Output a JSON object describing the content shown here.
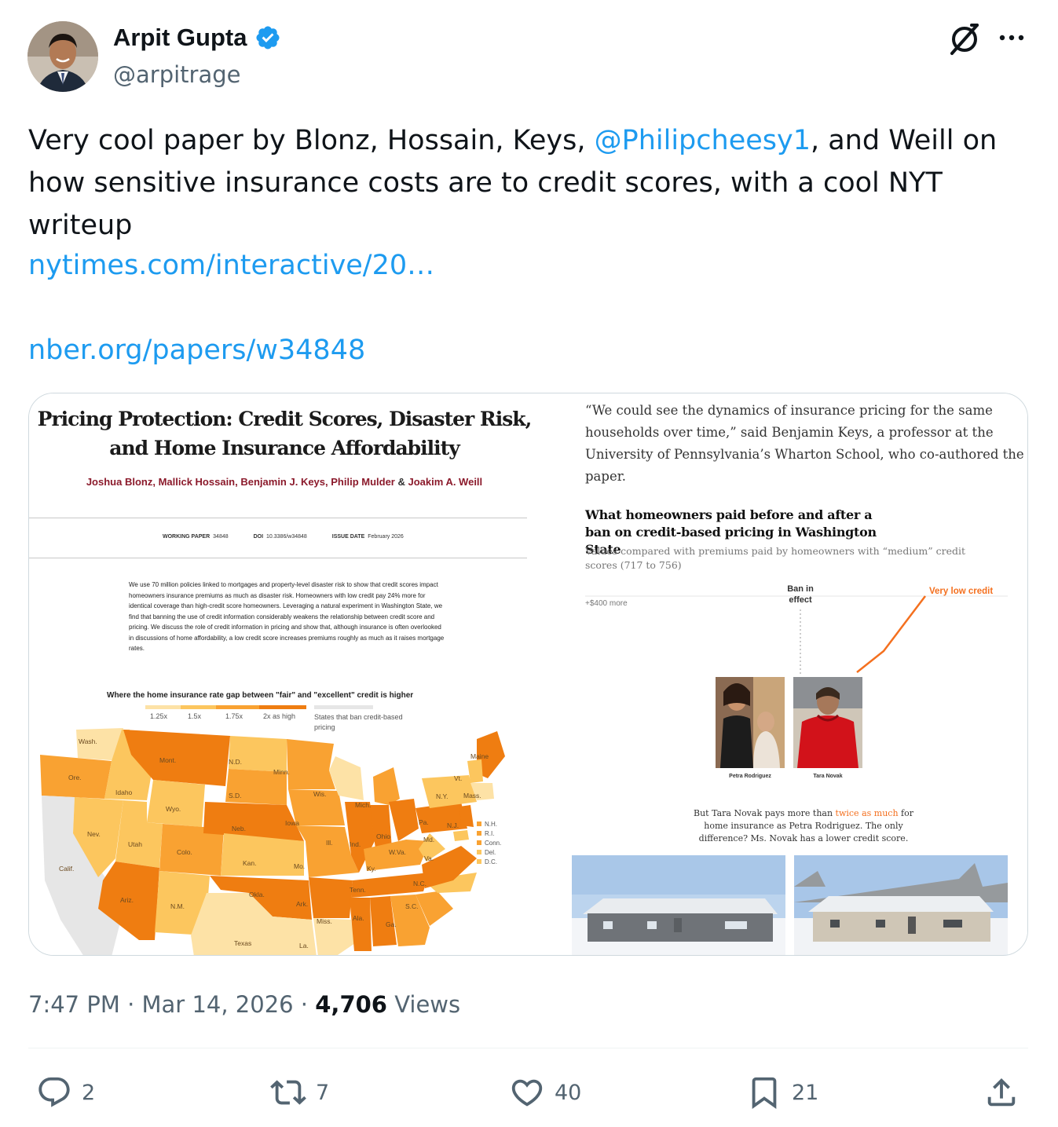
{
  "author": {
    "name": "Arpit Gupta",
    "handle": "@arpitrage"
  },
  "tweet": {
    "text_before": "Very cool paper by Blonz, Hossain, Keys, ",
    "mention": "@Philipcheesy1",
    "text_after": ", and Weill on how sensitive insurance costs are to credit scores, with a cool NYT writeup",
    "links": [
      "nytimes.com/interactive/20…",
      "nber.org/papers/w34848"
    ]
  },
  "paper": {
    "title": "Pricing Protection: Credit Scores, Disaster Risk, and Home Insurance Affordability",
    "authors": [
      "Joshua Blonz",
      "Mallick Hossain",
      "Benjamin J. Keys",
      "Philip Mulder",
      "Joakim A. Weill"
    ],
    "meta": {
      "wp_label": "WORKING PAPER",
      "wp_value": "34848",
      "doi_label": "DOI",
      "doi_value": "10.3386/w34848",
      "date_label": "ISSUE DATE",
      "date_value": "February 2026"
    },
    "abstract": "We use 70 million policies linked to mortgages and property-level disaster risk to show that credit scores impact homeowners insurance premiums as much as disaster risk. Homeowners with low credit pay 24% more for identical coverage than high-credit score homeowners. Leveraging a natural experiment in Washington State, we find that banning the use of credit information considerably weakens the relationship between credit score and pricing. We discuss the role of credit information in pricing and show that, although insurance is often overlooked in discussions of home affordability, a low credit score increases premiums roughly as much as it raises mortgage rates.",
    "map_title": "Where the home insurance rate gap between \"fair\" and \"excellent\" credit is higher",
    "legend": [
      "1.25x",
      "1.5x",
      "1.75x",
      "2x as high"
    ],
    "legend_ban": "States that ban credit-based pricing",
    "colors": {
      "c1": "#fde2a6",
      "c2": "#fcc65e",
      "c3": "#f9a232",
      "c4": "#ef7d11",
      "ban": "#e6e6e6"
    },
    "map_labels": [
      "Wash.",
      "Ore.",
      "Calif.",
      "Idaho",
      "Nev.",
      "Mont.",
      "Wyo.",
      "Utah",
      "Ariz.",
      "Colo.",
      "N.M.",
      "N.D.",
      "S.D.",
      "Neb.",
      "Kan.",
      "Okla.",
      "Texas",
      "Minn.",
      "Iowa",
      "Mo.",
      "Ark.",
      "La.",
      "Wis.",
      "Ill.",
      "Mich.",
      "Ind.",
      "Ohio",
      "Ky.",
      "Tenn.",
      "Miss.",
      "Ala.",
      "Ga.",
      "S.C.",
      "N.C.",
      "Va.",
      "W.Va.",
      "Md.",
      "Pa.",
      "N.J.",
      "N.Y.",
      "Vt.",
      "Mass.",
      "Maine"
    ],
    "ne_labels": [
      "N.H.",
      "R.I.",
      "Conn.",
      "Del.",
      "D.C."
    ]
  },
  "article": {
    "quote": "“We could see the dynamics of insurance pricing for the same households over time,” said Benjamin Keys, a professor at the University of Pennsylvania’s Wharton School, who co-authored the paper.",
    "chart_title": "What homeowners paid before and after a ban on credit-based pricing in Washington State",
    "chart_subtitle": "Values compared with premiums paid by homeowners with “medium” credit scores (717 to 756)",
    "y_label": "+$400 more",
    "ban_label": "Ban in effect",
    "line_label": "Very low credit",
    "line_color": "#f4701f",
    "photo1_name": "Petra Rodriguez",
    "photo2_name": "Tara Novak",
    "caption_before": "But Tara Novak pays more than ",
    "caption_highlight": "twice as much",
    "caption_after": " for home insurance as Petra Rodriguez. The only difference? Ms. Novak has a lower credit score."
  },
  "footer": {
    "time": "7:47 PM",
    "sep": " · ",
    "date": "Mar 14, 2026",
    "views_count": "4,706",
    "views_label": " Views"
  },
  "actions": {
    "replies": "2",
    "reposts": "7",
    "likes": "40",
    "bookmarks": "21"
  },
  "brand_color": "#1d9bf0"
}
